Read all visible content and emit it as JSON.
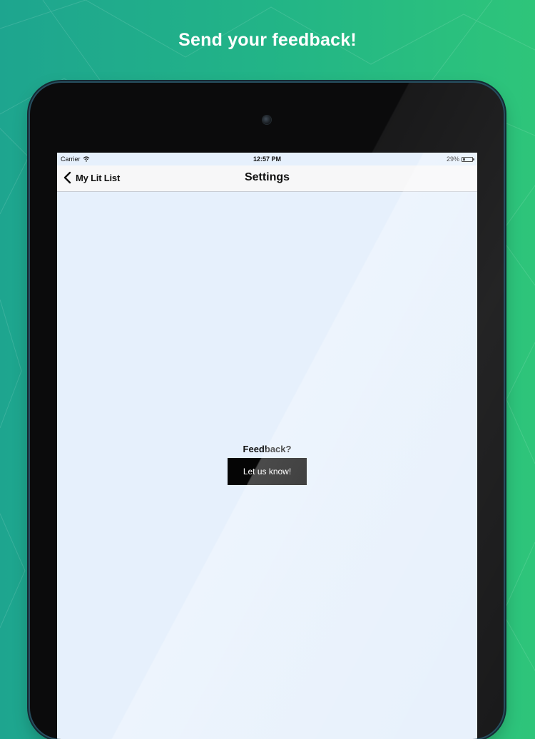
{
  "promo": {
    "headline": "Send your feedback!"
  },
  "status_bar": {
    "carrier": "Carrier",
    "wifi_icon": "wifi-icon",
    "time": "12:57 PM",
    "battery_percent": "29%",
    "battery_level": 0.29
  },
  "nav": {
    "back_label": "My Lit List",
    "back_icon": "chevron-left-icon",
    "title": "Settings"
  },
  "feedback": {
    "label": "Feedback?",
    "button_label": "Let us know!"
  },
  "colors": {
    "background_gradient_start": "#1ea58f",
    "background_gradient_end": "#2ec57a",
    "screen_background": "#e6f0fc",
    "button_background": "#050505",
    "button_text": "#ffffff"
  }
}
